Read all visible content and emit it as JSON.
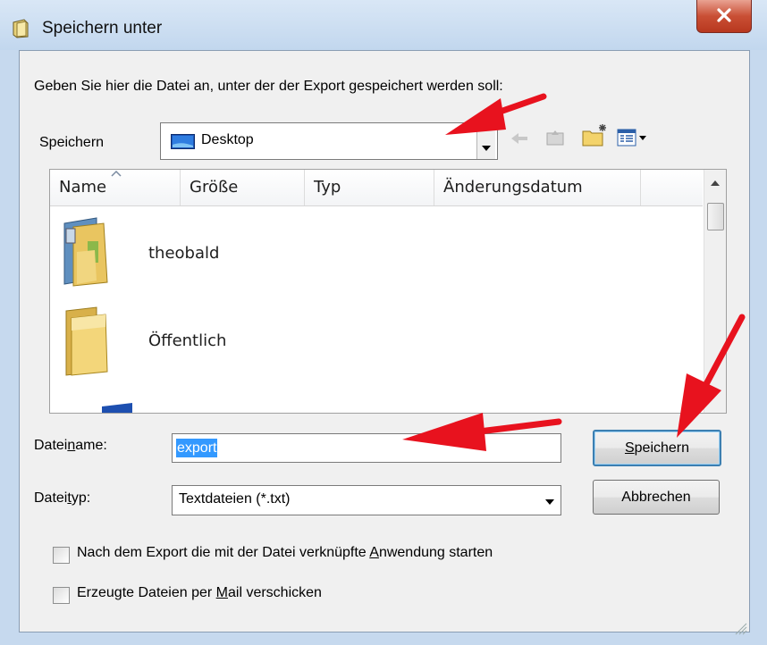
{
  "window": {
    "title": "Speichern unter",
    "close_label": "x"
  },
  "prompt": "Geben Sie hier die Datei an, unter der der Export gespeichert werden soll:",
  "save_in": {
    "label": "Speichern",
    "value": "Desktop"
  },
  "toolbar": {
    "icons": [
      "back-icon",
      "up-folder-icon",
      "new-folder-icon",
      "view-menu-icon"
    ]
  },
  "file_list": {
    "columns": [
      "Name",
      "Größe",
      "Typ",
      "Änderungsdatum"
    ],
    "items": [
      {
        "label": "theobald",
        "icon": "user-folder-icon"
      },
      {
        "label": "Öffentlich",
        "icon": "folder-icon"
      }
    ]
  },
  "filename": {
    "label_pre": "Datei",
    "label_mnemonic": "n",
    "label_post": "ame:",
    "value": "export"
  },
  "filetype": {
    "label_pre": "Datei",
    "label_mnemonic": "t",
    "label_post": "yp:",
    "value": "Textdateien (*.txt)"
  },
  "buttons": {
    "save_mnemonic": "S",
    "save_rest": "peichern",
    "cancel": "Abbrechen"
  },
  "options": {
    "launch_pre": "Nach dem Export die mit der Datei verknüpfte ",
    "launch_mnemonic": "A",
    "launch_post": "nwendung starten",
    "launch_checked": false,
    "mail_pre": "Erzeugte Dateien per ",
    "mail_mnemonic": "M",
    "mail_post": "ail verschicken",
    "mail_checked": false
  },
  "colors": {
    "annotation_arrow": "#e8121e",
    "selection": "#3399ff"
  }
}
